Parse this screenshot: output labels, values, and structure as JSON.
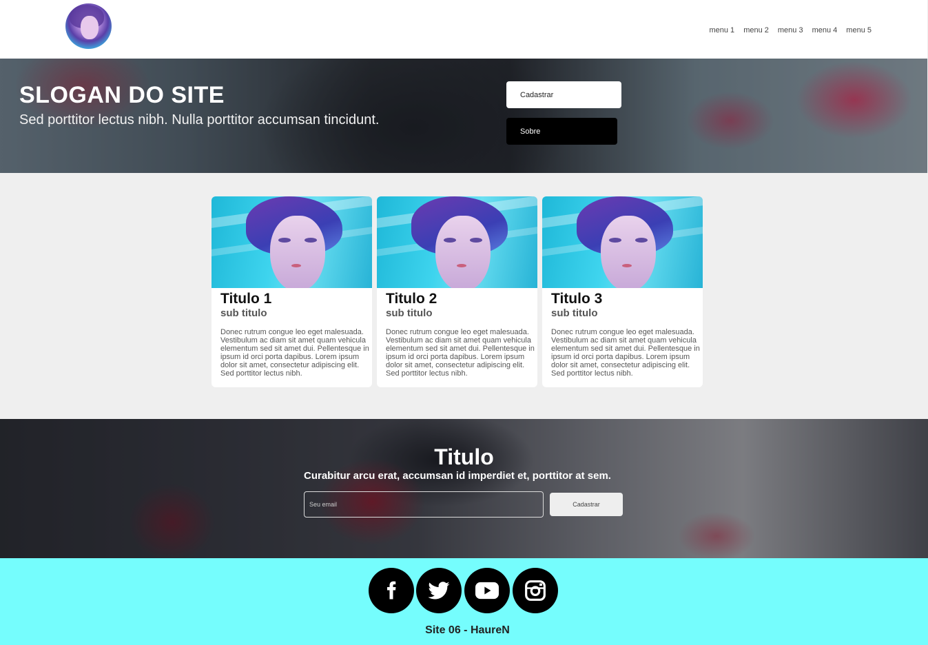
{
  "header": {
    "nav": [
      "menu 1",
      "menu 2",
      "menu 3",
      "menu 4",
      "menu 5"
    ]
  },
  "hero": {
    "title": "SLOGAN DO SITE",
    "subtitle": "Sed porttitor lectus nibh. Nulla porttitor accumsan tincidunt.",
    "primary_button": "Cadastrar",
    "secondary_button": "Sobre"
  },
  "cards": [
    {
      "title": "Titulo 1",
      "subtitle": "sub titulo",
      "text": "Donec rutrum congue leo eget malesuada. Vestibulum ac diam sit amet quam vehicula elementum sed sit amet dui. Pellentesque in ipsum id orci porta dapibus. Lorem ipsum dolor sit amet, consectetur adipiscing elit. Sed porttitor lectus nibh."
    },
    {
      "title": "Titulo 2",
      "subtitle": "sub titulo",
      "text": "Donec rutrum congue leo eget malesuada. Vestibulum ac diam sit amet quam vehicula elementum sed sit amet dui. Pellentesque in ipsum id orci porta dapibus. Lorem ipsum dolor sit amet, consectetur adipiscing elit. Sed porttitor lectus nibh."
    },
    {
      "title": "Titulo 3",
      "subtitle": "sub titulo",
      "text": "Donec rutrum congue leo eget malesuada. Vestibulum ac diam sit amet quam vehicula elementum sed sit amet dui. Pellentesque in ipsum id orci porta dapibus. Lorem ipsum dolor sit amet, consectetur adipiscing elit. Sed porttitor lectus nibh."
    }
  ],
  "newsletter": {
    "title": "Titulo",
    "subtitle": "Curabitur arcu erat, accumsan id imperdiet et, porttitor at sem.",
    "email_placeholder": "Seu email",
    "button": "Cadastrar"
  },
  "footer": {
    "social_icons": [
      "facebook-icon",
      "twitter-icon",
      "youtube-icon",
      "instagram-icon"
    ],
    "text": "Site 06 - HaureN",
    "background": "#75fdfd"
  }
}
